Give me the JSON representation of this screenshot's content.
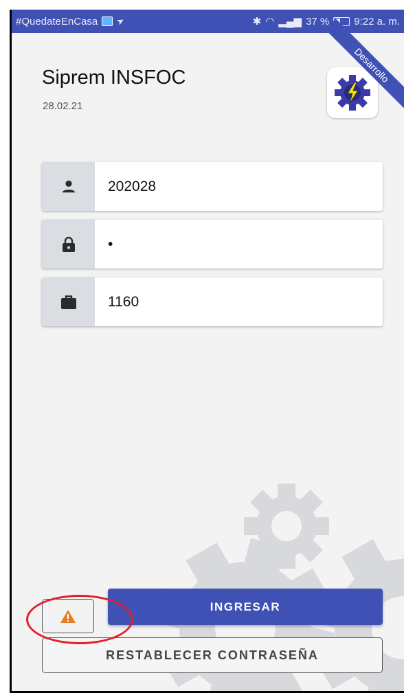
{
  "status_bar": {
    "left_text": "#QuedateEnCasa",
    "right_text": "37 %",
    "time": "9:22 a. m."
  },
  "ribbon": {
    "label": "Desarrollo"
  },
  "header": {
    "title": "Siprem INSFOC",
    "date": "28.02.21"
  },
  "form": {
    "user": {
      "icon": "person-icon",
      "value": "202028"
    },
    "password": {
      "icon": "lock-icon",
      "value": "•"
    },
    "company": {
      "icon": "briefcase-icon",
      "value": "1160"
    }
  },
  "buttons": {
    "warning_icon": "warning-icon",
    "login_label": "INGRESAR",
    "reset_label": "RESTABLECER CONTRASEÑA"
  },
  "colors": {
    "primary": "#3f51b5",
    "warning": "#e67e22",
    "annotation": "#e0202a"
  }
}
